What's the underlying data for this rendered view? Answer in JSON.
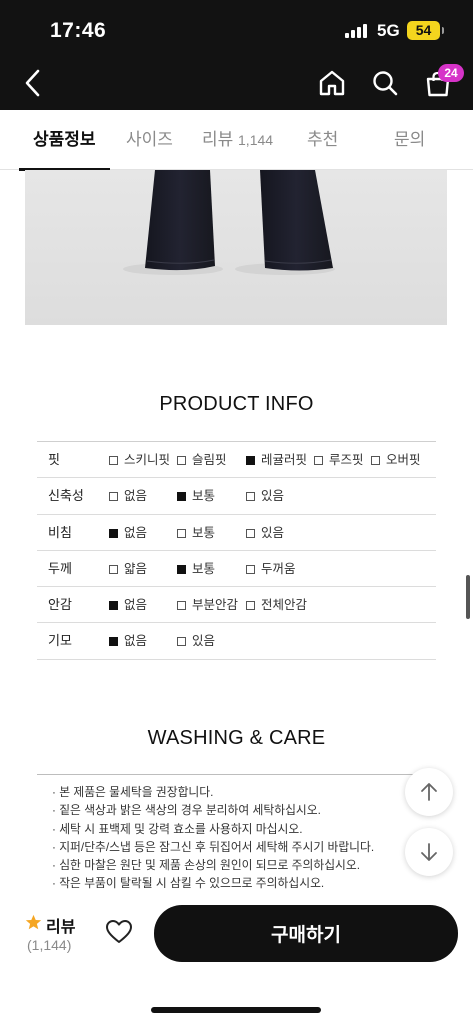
{
  "status_bar": {
    "time": "17:46",
    "network": "5G",
    "battery": "54"
  },
  "header": {
    "icons": {
      "back": "chevron-left-icon",
      "home": "home-icon",
      "search": "search-icon",
      "bag": "shopping-bag-icon"
    },
    "cart_count": "24"
  },
  "tabs": [
    {
      "label": "상품정보",
      "count": "",
      "active": true
    },
    {
      "label": "사이즈",
      "count": "",
      "active": false
    },
    {
      "label": "리뷰",
      "count": "1,144",
      "active": false
    },
    {
      "label": "추천",
      "count": "",
      "active": false
    },
    {
      "label": "문의",
      "count": "",
      "active": false
    }
  ],
  "product_info": {
    "title": "PRODUCT INFO",
    "rows": [
      {
        "label": "핏",
        "options": [
          {
            "label": "스키니핏",
            "checked": false
          },
          {
            "label": "슬림핏",
            "checked": false
          },
          {
            "label": "레귤러핏",
            "checked": true
          },
          {
            "label": "루즈핏",
            "checked": false
          },
          {
            "label": "오버핏",
            "checked": false
          }
        ]
      },
      {
        "label": "신축성",
        "options": [
          {
            "label": "없음",
            "checked": false
          },
          {
            "label": "보통",
            "checked": true
          },
          {
            "label": "있음",
            "checked": false
          }
        ]
      },
      {
        "label": "비침",
        "options": [
          {
            "label": "없음",
            "checked": true
          },
          {
            "label": "보통",
            "checked": false
          },
          {
            "label": "있음",
            "checked": false
          }
        ]
      },
      {
        "label": "두께",
        "options": [
          {
            "label": "얇음",
            "checked": false
          },
          {
            "label": "보통",
            "checked": true
          },
          {
            "label": "두꺼움",
            "checked": false
          }
        ]
      },
      {
        "label": "안감",
        "options": [
          {
            "label": "없음",
            "checked": true
          },
          {
            "label": "부분안감",
            "checked": false
          },
          {
            "label": "전체안감",
            "checked": false
          }
        ]
      },
      {
        "label": "기모",
        "options": [
          {
            "label": "없음",
            "checked": true
          },
          {
            "label": "있음",
            "checked": false
          }
        ]
      }
    ]
  },
  "washing_care": {
    "title": "WASHING & CARE",
    "items": [
      "· 본 제품은 물세탁을 권장합니다.",
      "· 짙은 색상과 밝은 색상의 경우 분리하여 세탁하십시오.",
      "· 세탁 시 표백제 및 강력 효소를 사용하지 마십시오.",
      "· 지퍼/단추/스냅 등은 잠그신 후 뒤집어서 세탁해 주시기 바랍니다.",
      "· 심한 마찰은 원단 및 제품 손상의 원인이 되므로 주의하십시오.",
      "· 작은 부품이 탈락될 시 삼킬 수 있으므로 주의하십시오."
    ]
  },
  "floating": {
    "up_icon": "arrow-up-icon",
    "down_icon": "arrow-down-icon"
  },
  "bottom_bar": {
    "review_label": "리뷰",
    "review_count": "(1,144)",
    "star_icon": "star-icon",
    "star_color": "#f5a623",
    "wishlist_icon": "heart-icon",
    "buy_label": "구매하기"
  }
}
